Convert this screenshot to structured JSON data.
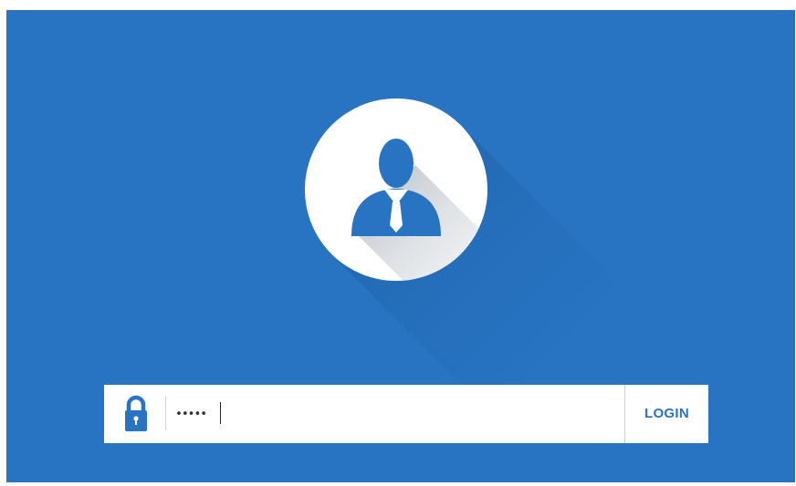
{
  "login": {
    "password_value": "•••••",
    "button_label": "LOGIN"
  },
  "icons": {
    "avatar": "user-avatar-icon",
    "lock": "lock-icon"
  },
  "colors": {
    "background": "#2874c3",
    "accent": "#2874c3",
    "panel": "#ffffff"
  }
}
